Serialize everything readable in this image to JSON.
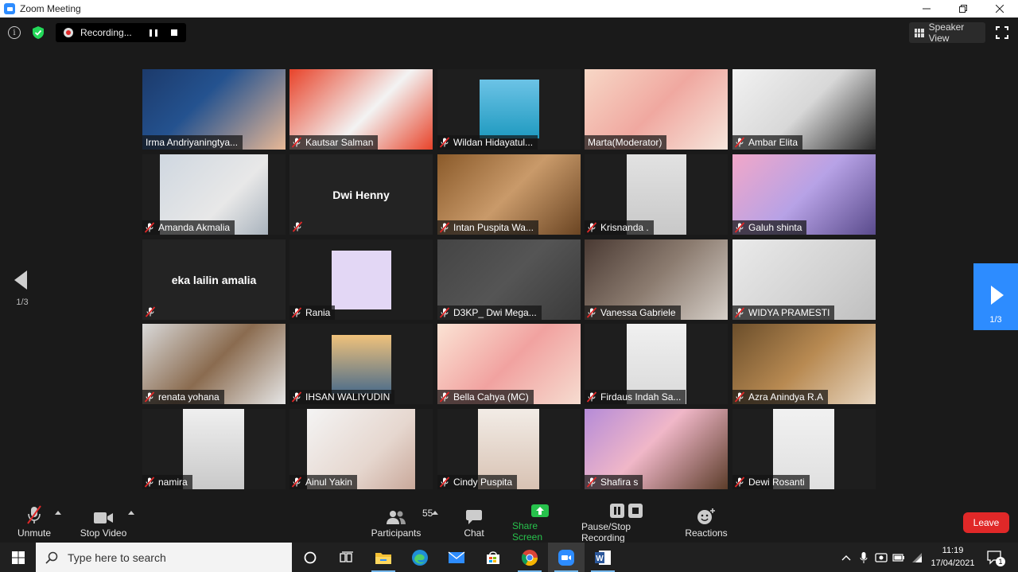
{
  "window": {
    "title": "Zoom Meeting",
    "controls": [
      "minimize-icon",
      "restore-icon",
      "close-icon"
    ]
  },
  "topbar": {
    "recording_label": "Recording...",
    "speaker_view_label": "Speaker View"
  },
  "gallery": {
    "page_indicator_left": "1/3",
    "page_indicator_right": "1/3",
    "participants": [
      {
        "name": "Irma Andriyaningtya...",
        "muted": false,
        "video": true
      },
      {
        "name": "Kautsar Salman",
        "muted": true,
        "video": true
      },
      {
        "name": "Wildan Hidayatul...",
        "muted": true,
        "video": true
      },
      {
        "name": "Marta(Moderator)",
        "muted": false,
        "video": true,
        "active_speaker": true
      },
      {
        "name": "Ambar Elita",
        "muted": true,
        "video": true
      },
      {
        "name": "Amanda Akmalia",
        "muted": true,
        "video": true
      },
      {
        "name": "Dwi Henny",
        "muted": true,
        "video": false
      },
      {
        "name": "Intan Puspita Wa...",
        "muted": true,
        "video": true
      },
      {
        "name": "Krisnanda .",
        "muted": true,
        "video": true
      },
      {
        "name": "Galuh shinta",
        "muted": true,
        "video": true
      },
      {
        "name": "eka lailin amalia",
        "muted": true,
        "video": false
      },
      {
        "name": "Rania",
        "muted": true,
        "video": true
      },
      {
        "name": "D3KP_ Dwi Mega...",
        "muted": true,
        "video": true
      },
      {
        "name": "Vanessa Gabriele",
        "muted": true,
        "video": true
      },
      {
        "name": "WIDYA PRAMESTI",
        "muted": true,
        "video": true
      },
      {
        "name": "renata yohana",
        "muted": true,
        "video": true
      },
      {
        "name": "IHSAN WALIYUDIN",
        "muted": true,
        "video": true
      },
      {
        "name": "Bella Cahya (MC)",
        "muted": true,
        "video": true
      },
      {
        "name": "Firdaus Indah Sa...",
        "muted": true,
        "video": true
      },
      {
        "name": "Azra Anindya R.A",
        "muted": true,
        "video": true
      },
      {
        "name": "namira",
        "muted": true,
        "video": true
      },
      {
        "name": "Ainul Yakin",
        "muted": true,
        "video": true
      },
      {
        "name": "Cindy Puspita",
        "muted": true,
        "video": true
      },
      {
        "name": "Shafira s",
        "muted": true,
        "video": true
      },
      {
        "name": "Dewi Rosanti",
        "muted": true,
        "video": true
      }
    ]
  },
  "toolbar": {
    "unmute": "Unmute",
    "stop_video": "Stop Video",
    "participants": "Participants",
    "participants_count": "55",
    "chat": "Chat",
    "share_screen": "Share Screen",
    "pause_stop_recording": "Pause/Stop Recording",
    "reactions": "Reactions",
    "leave": "Leave"
  },
  "taskbar": {
    "search_placeholder": "Type here to search",
    "apps": [
      "cortana-icon",
      "task-view-icon",
      "file-explorer-icon",
      "edge-icon",
      "mail-icon",
      "store-icon",
      "chrome-icon",
      "zoom-icon",
      "word-icon"
    ],
    "time": "11:19",
    "date": "17/04/2021",
    "notification_count": "1"
  },
  "colors": {
    "zoom_blue": "#2d8cff",
    "active_speaker_outline": "#c7e36b",
    "muted_red": "#e02828",
    "share_green": "#27c24c"
  }
}
